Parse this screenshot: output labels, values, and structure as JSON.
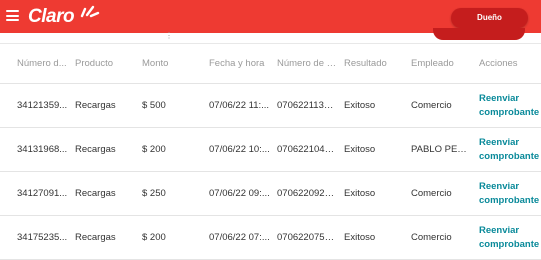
{
  "header": {
    "brand": "Claro",
    "role_button": "Dueño",
    "brand_color": "#ee3a32",
    "accent_color": "#c51d1d",
    "link_color": "#0a8a9a"
  },
  "table": {
    "columns": [
      "Número d...",
      "Producto",
      "Monto",
      "Fecha y hora",
      "Número de tr...",
      "Resultado",
      "Empleado",
      "Acciones"
    ],
    "rows": [
      {
        "numero": "34121359...",
        "producto": "Recargas",
        "monto": "$ 500",
        "fecha": "07/06/22 11:...",
        "transaccion": "0706221135...",
        "resultado": "Exitoso",
        "empleado": "Comercio",
        "accion": "Reenviar comprobante"
      },
      {
        "numero": "34131968...",
        "producto": "Recargas",
        "monto": "$ 200",
        "fecha": "07/06/22 10:...",
        "transaccion": "0706221048...",
        "resultado": "Exitoso",
        "empleado": "PABLO PERS...",
        "accion": "Reenviar comprobante"
      },
      {
        "numero": "34127091...",
        "producto": "Recargas",
        "monto": "$ 250",
        "fecha": "07/06/22 09:...",
        "transaccion": "0706220928...",
        "resultado": "Exitoso",
        "empleado": "Comercio",
        "accion": "Reenviar comprobante"
      },
      {
        "numero": "34175235...",
        "producto": "Recargas",
        "monto": "$ 200",
        "fecha": "07/06/22 07:...",
        "transaccion": "0706220750...",
        "resultado": "Exitoso",
        "empleado": "Comercio",
        "accion": "Reenviar comprobante"
      }
    ]
  }
}
